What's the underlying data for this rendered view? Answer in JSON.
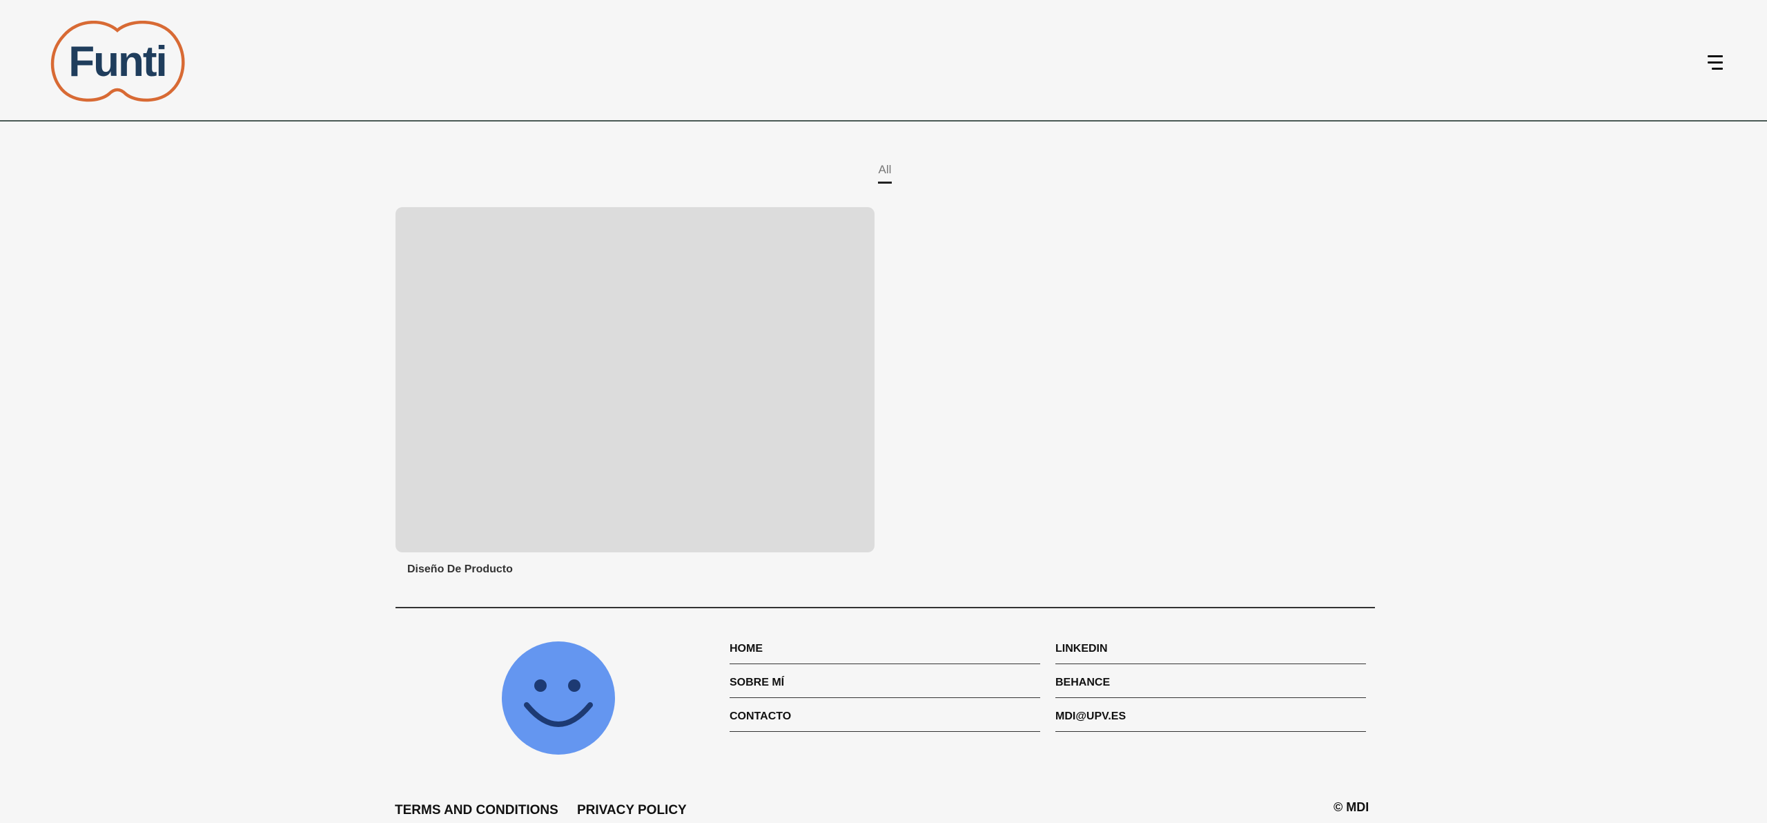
{
  "header": {
    "logo_text": "Funti",
    "menu_icon": "hamburger-menu-icon"
  },
  "filters": {
    "active": "All"
  },
  "portfolio": {
    "items": [
      {
        "caption": "Diseño De Producto"
      }
    ]
  },
  "footer": {
    "avatar_icon": "smiley-face-icon",
    "nav_links": [
      "HOME",
      "SOBRE MÍ",
      "CONTACTO"
    ],
    "social_links": [
      "LINKEDIN",
      "BEHANCE",
      "MDI@UPV.ES"
    ],
    "terms": "TERMS AND CONDITIONS",
    "privacy": "PRIVACY POLICY",
    "copyright": "© MDI"
  },
  "colors": {
    "background": "#f6f6f6",
    "logo_outline": "#d86a34",
    "logo_text": "#1f3d5c",
    "smiley_fill": "#6496f0",
    "smiley_features": "#1d3a73",
    "card_placeholder": "#dcdcdc"
  }
}
